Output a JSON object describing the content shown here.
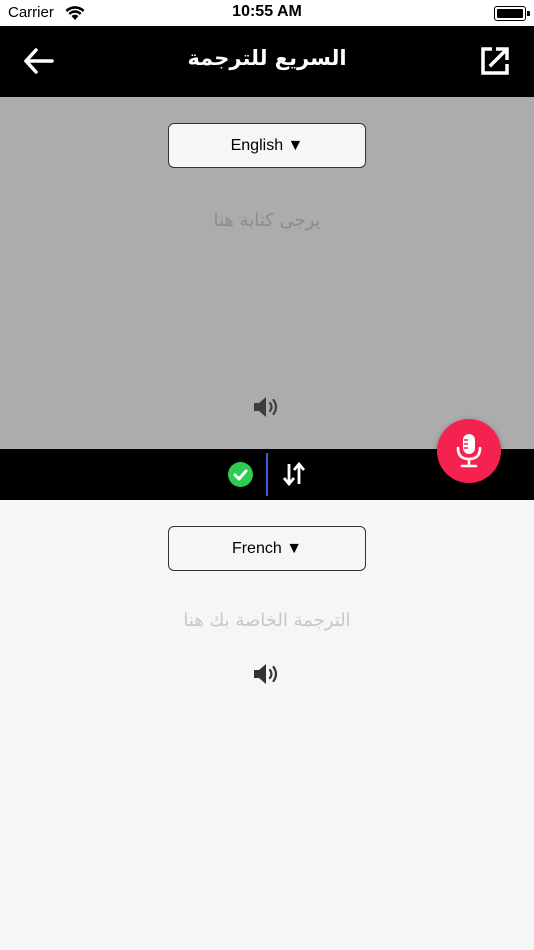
{
  "status_bar": {
    "carrier": "Carrier",
    "time": "10:55 AM"
  },
  "nav": {
    "title": "السريع للترجمة",
    "back_icon": "arrow-left-icon",
    "share_icon": "external-link-icon"
  },
  "source": {
    "language_label": "English ▼",
    "placeholder": "يرجى كتابة هنا",
    "speaker_icon": "speaker-icon"
  },
  "actions": {
    "check_icon": "check-circle-icon",
    "swap_icon": "swap-vertical-icon",
    "mic_icon": "microphone-icon"
  },
  "target": {
    "language_label": "French ▼",
    "placeholder": "الترجمة الخاصة بك هنا",
    "speaker_icon": "speaker-icon"
  },
  "colors": {
    "nav_background": "#000000",
    "source_background": "#acacac",
    "target_background": "#f5f6f8",
    "mic_button": "#f5224f",
    "check_green": "#2ecc51",
    "divider_blue": "#3b5bdb"
  }
}
